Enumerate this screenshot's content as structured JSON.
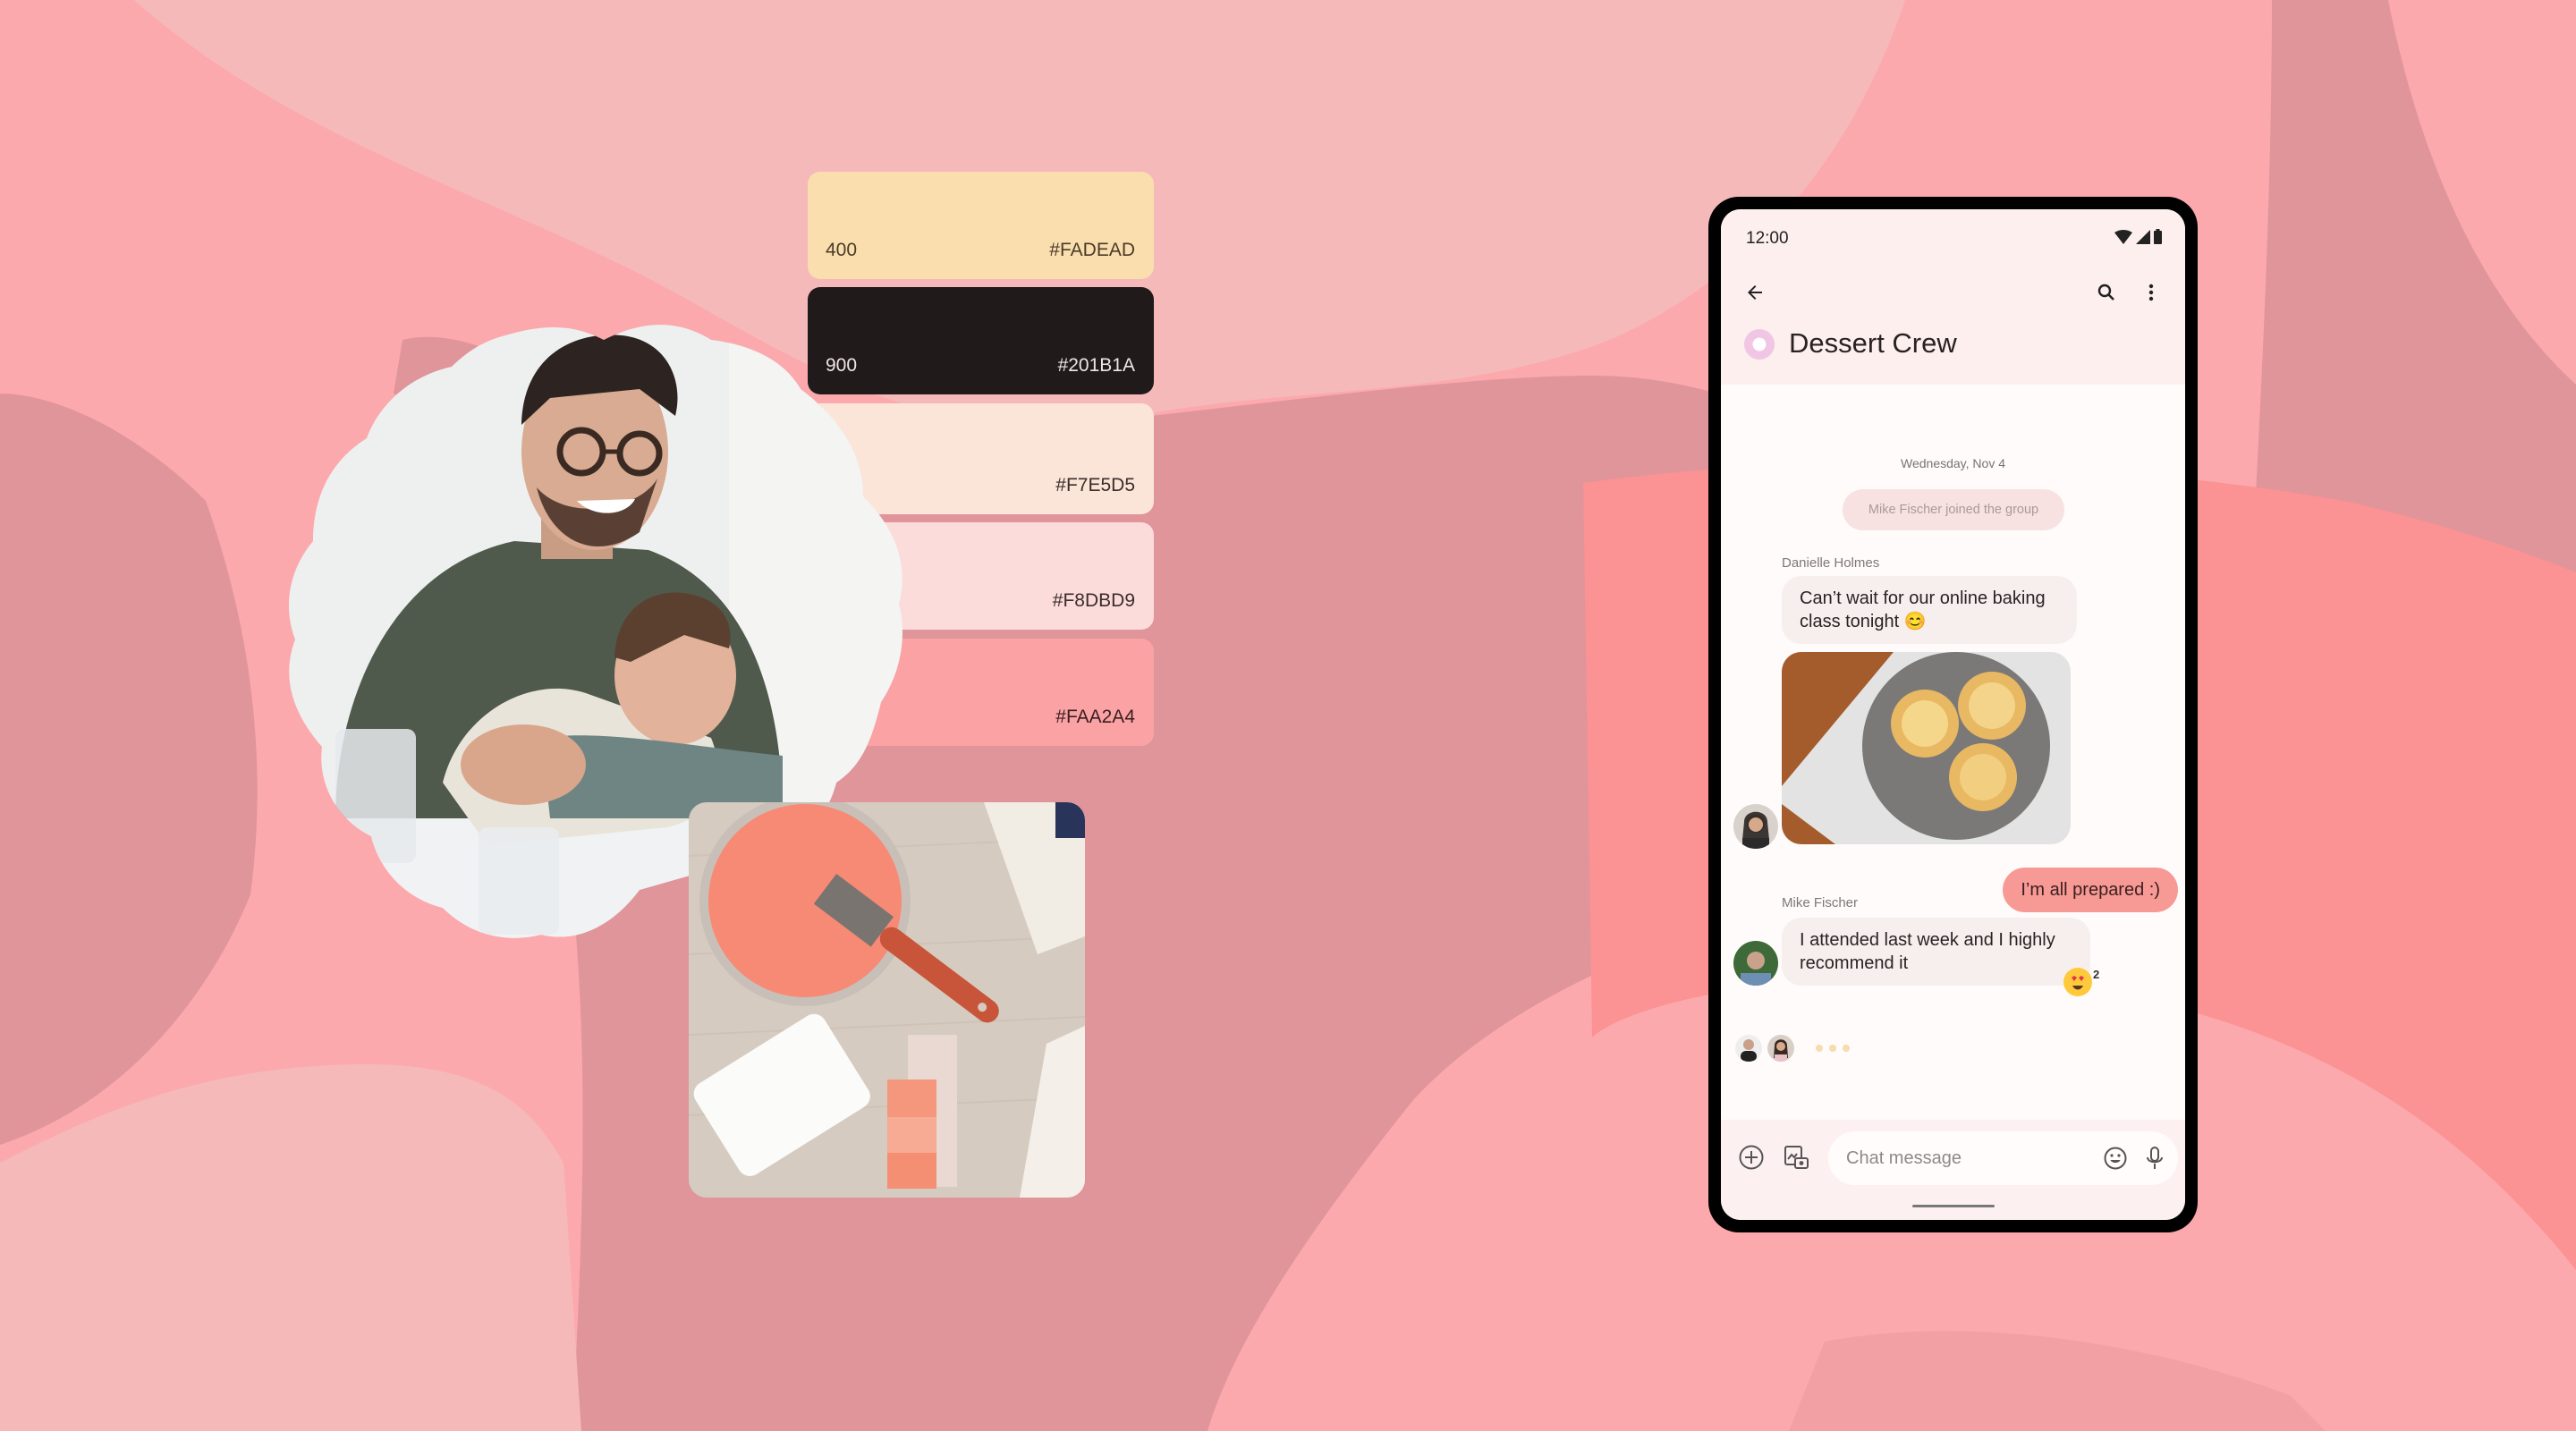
{
  "palette": {
    "swatches": [
      {
        "tone": "400",
        "hex": "#FADEAD"
      },
      {
        "tone": "900",
        "hex": "#201B1A"
      },
      {
        "tone": "",
        "hex": "#F7E5D5"
      },
      {
        "tone": "",
        "hex": "#F8DBD9"
      },
      {
        "tone": "",
        "hex": "#FAA2A4"
      }
    ]
  },
  "photos": {
    "family": "Smiling father hugging laughing son",
    "paint": "Coral paint can with brush and paint swatches"
  },
  "phone": {
    "status_bar": {
      "time": "12:00",
      "icons": [
        "wifi-icon",
        "signal-icon",
        "battery-icon"
      ]
    },
    "app_bar": {
      "back": "back-arrow-icon",
      "search": "search-icon",
      "more": "more-vert-icon",
      "group_name": "Dessert Crew"
    },
    "conversation": {
      "date_separator": "Wednesday, Nov 4",
      "system_message": "Mike Fischer joined the group",
      "messages": [
        {
          "sender": "Danielle Holmes",
          "text": "Can’t wait for our online baking class tonight 😊",
          "attachment": "Photo of egg tarts on a grey plate"
        },
        {
          "sender": "Me",
          "text": "I’m all prepared :)"
        },
        {
          "sender": "Mike Fischer",
          "text": "I attended last week and I highly recommend it",
          "reaction": {
            "emoji": "😍",
            "count": "2"
          }
        }
      ],
      "typing_indicator": "typing"
    },
    "composer": {
      "placeholder": "Chat message",
      "value": ""
    }
  }
}
